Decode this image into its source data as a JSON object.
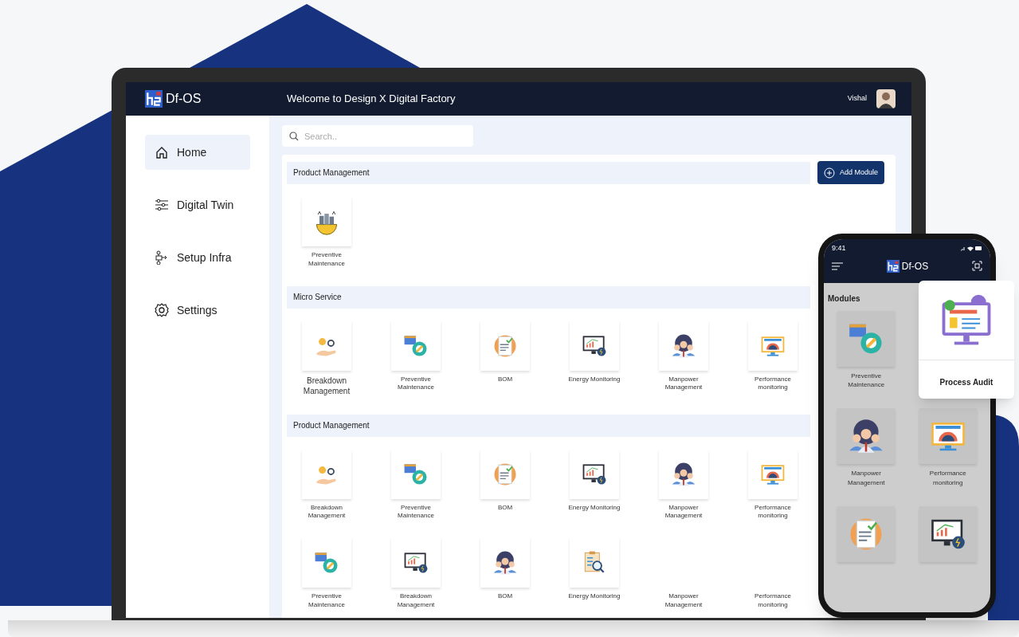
{
  "app": {
    "logo": "Df-OS",
    "title": "Welcome to Design X Digital Factory",
    "user": "Vishal"
  },
  "sidebar": {
    "items": [
      {
        "label": "Home",
        "kind": "home",
        "selected": true
      },
      {
        "label": "Digital Twin",
        "kind": "sliders",
        "selected": false
      },
      {
        "label": "Setup Infra",
        "kind": "infra",
        "selected": false
      },
      {
        "label": "Settings",
        "kind": "gear",
        "selected": false
      }
    ]
  },
  "search": {
    "placeholder": "Search.."
  },
  "sections": [
    {
      "title": "Product Management",
      "action": "Add Module",
      "modules": [
        {
          "label": "Preventive Maintenance",
          "kind": "factory-gear"
        }
      ]
    },
    {
      "title": "Micro Service",
      "modules": [
        {
          "label": "Breakdown Management",
          "kind": "hand-gears",
          "large": true
        },
        {
          "label": "Preventive Maintenance",
          "kind": "calendar-gear"
        },
        {
          "label": "BOM",
          "kind": "bill"
        },
        {
          "label": "Energy Monitoring",
          "kind": "monitor-chart"
        },
        {
          "label": "Manpower Management",
          "kind": "people-gear"
        },
        {
          "label": "Performance monitoring",
          "kind": "monitor-gauge"
        }
      ]
    },
    {
      "title": "Product Management",
      "modules": [
        {
          "label": "Breakdown Management",
          "kind": "hand-gears"
        },
        {
          "label": "Preventive Maintenance",
          "kind": "calendar-gear"
        },
        {
          "label": "BOM",
          "kind": "bill"
        },
        {
          "label": "Energy Monitoring",
          "kind": "monitor-chart"
        },
        {
          "label": "Manpower Management",
          "kind": "people-gear"
        },
        {
          "label": "Performance monitoring",
          "kind": "monitor-gauge"
        },
        {
          "label": "Preventive Maintenance",
          "kind": "calendar-gear"
        },
        {
          "label": "Breakdown Management",
          "kind": "monitor-chart"
        },
        {
          "label": "BOM",
          "kind": "people-gear"
        },
        {
          "label": "Energy Monitoring",
          "kind": "clipboard-search"
        },
        {
          "label": "Manpower Management",
          "kind": "blank"
        },
        {
          "label": "Performance monitoring",
          "kind": "blank"
        }
      ]
    }
  ],
  "phone": {
    "time": "9:41",
    "logo": "Df-OS",
    "heading": "Modules",
    "modules": [
      {
        "label": "Preventive Maintenance",
        "kind": "calendar-gear"
      },
      {
        "label": "Manpower Management",
        "kind": "people-gear"
      },
      {
        "label": "Performance monitoring",
        "kind": "monitor-gauge"
      },
      {
        "kind": "bill"
      },
      {
        "kind": "monitor-chart"
      }
    ],
    "popup": {
      "label": "Process Audit",
      "kind": "monitor-audit"
    }
  }
}
